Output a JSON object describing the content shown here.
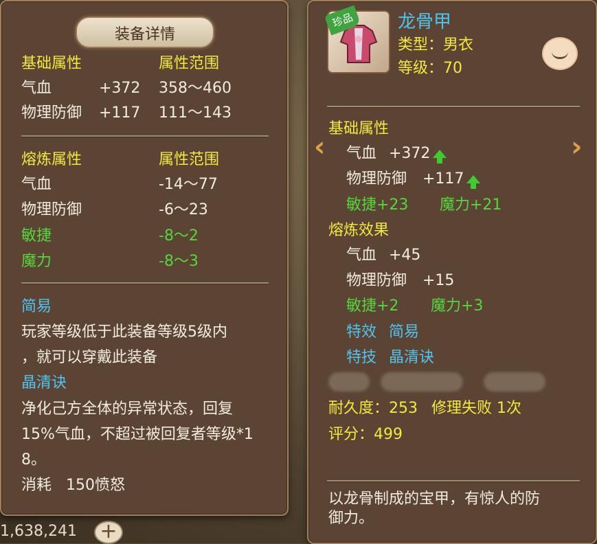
{
  "left_panel": {
    "title": "装备详情",
    "basic_header": "基础属性",
    "range_header": "属性范围",
    "basic_rows": [
      {
        "name": "气血",
        "value": "+372",
        "range": "358～460"
      },
      {
        "name": "物理防御",
        "value": "+117",
        "range": "111～143"
      }
    ],
    "refine_header": "熔炼属性",
    "refine_range_header": "属性范围",
    "refine_rows": [
      {
        "name": "气血",
        "range": "-14～77"
      },
      {
        "name": "物理防御",
        "range": "-6～23"
      },
      {
        "name": "敏捷",
        "range": "-8～2"
      },
      {
        "name": "魔力",
        "range": "-8～3"
      }
    ],
    "effect1_name": "简易",
    "effect1_desc_line1": "玩家等级低于此装备等级5级内",
    "effect1_desc_line2": "，就可以穿戴此装备",
    "effect2_name": "晶清诀",
    "effect2_desc_line1": "净化己方全体的异常状态，回复",
    "effect2_desc_line2": "15%气血，不超过被回复者等级*1",
    "effect2_desc_line3": "8。",
    "cost_label": "消耗",
    "cost_value": "150愤怒"
  },
  "right_panel": {
    "badge": "珍品",
    "item_name": "龙骨甲",
    "type_label": "类型：男衣",
    "level_label": "等级：70",
    "basic_header": "基础属性",
    "basic_rows": [
      {
        "name": "气血",
        "value": "+372"
      },
      {
        "name": "物理防御",
        "value": "+117"
      }
    ],
    "bonus_1": "敏捷+23",
    "bonus_2": "魔力+21",
    "refine_header": "熔炼效果",
    "refine_rows": [
      {
        "name": "气血",
        "value": "+45"
      },
      {
        "name": "物理防御",
        "value": "+15"
      }
    ],
    "refine_bonus_1": "敏捷+2",
    "refine_bonus_2": "魔力+3",
    "special_effect_label": "特效",
    "special_effect_value": "简易",
    "special_skill_label": "特技",
    "special_skill_value": "晶清诀",
    "durability": "耐久度：253",
    "repair_fail": "修理失败 1次",
    "score": "评分：499",
    "description_line1": "以龙骨制成的宝甲，有惊人的防",
    "description_line2": "御力。"
  },
  "background": {
    "gold_text": "1,638,241",
    "icons": {
      "prev": "chevron-left-icon",
      "next": "chevron-right-icon",
      "eye": "eye-closed-icon",
      "up": "arrow-up-icon",
      "plus": "plus-icon"
    }
  }
}
